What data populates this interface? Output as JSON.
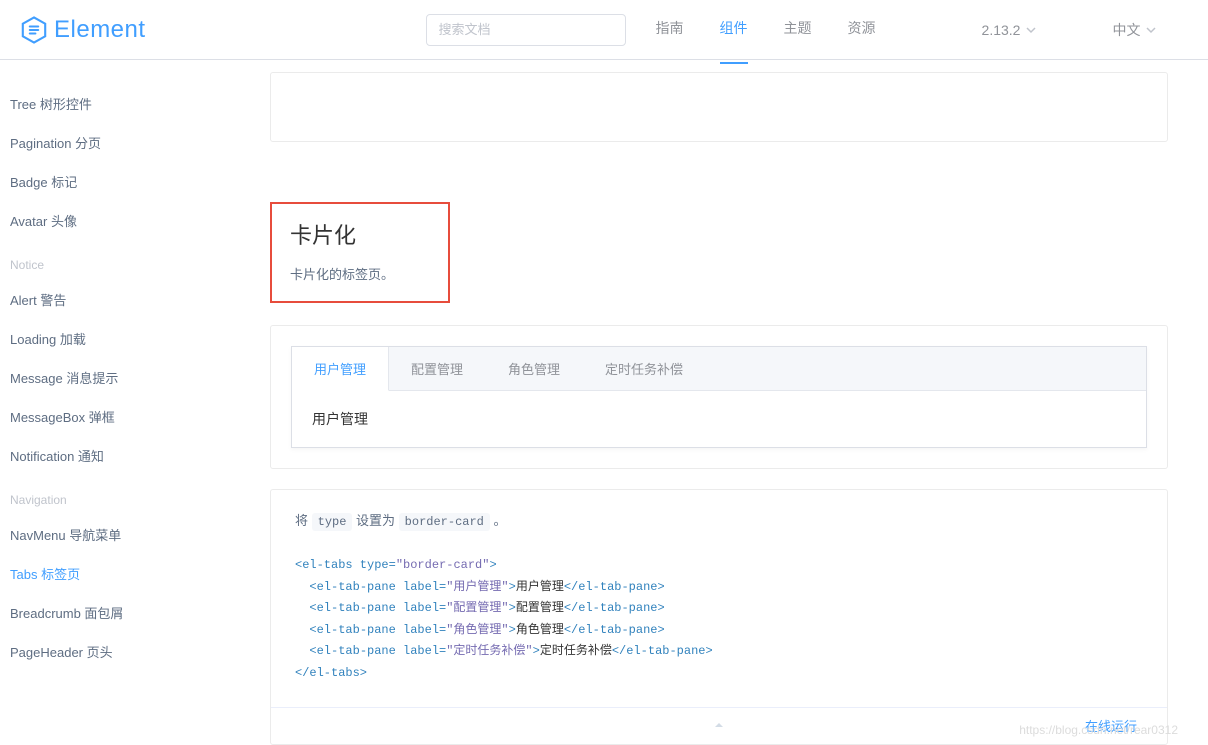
{
  "header": {
    "logo_text": "Element",
    "search_placeholder": "搜索文档",
    "nav": [
      {
        "label": "指南",
        "active": false
      },
      {
        "label": "组件",
        "active": true
      },
      {
        "label": "主题",
        "active": false
      },
      {
        "label": "资源",
        "active": false
      }
    ],
    "version": "2.13.2",
    "lang": "中文"
  },
  "sidebar": {
    "items_top": [
      "Tree 树形控件",
      "Pagination 分页",
      "Badge 标记",
      "Avatar 头像"
    ],
    "group_notice": "Notice",
    "items_notice": [
      "Alert 警告",
      "Loading 加载",
      "Message 消息提示",
      "MessageBox 弹框",
      "Notification 通知"
    ],
    "group_nav": "Navigation",
    "items_nav": [
      {
        "label": "NavMenu 导航菜单",
        "active": false
      },
      {
        "label": "Tabs 标签页",
        "active": true
      },
      {
        "label": "Breadcrumb 面包屑",
        "active": false
      },
      {
        "label": "PageHeader 页头",
        "active": false
      }
    ]
  },
  "section": {
    "title": "卡片化",
    "desc": "卡片化的标签页。"
  },
  "demo": {
    "tabs": [
      {
        "label": "用户管理",
        "active": true
      },
      {
        "label": "配置管理",
        "active": false
      },
      {
        "label": "角色管理",
        "active": false
      },
      {
        "label": "定时任务补偿",
        "active": false
      }
    ],
    "body": "用户管理"
  },
  "code_desc": {
    "pre": "将 ",
    "c1": "type",
    "mid": " 设置为 ",
    "c2": "border-card",
    "post": " 。"
  },
  "code": {
    "l1_open": "<el-tabs type=",
    "l1_str": "\"border-card\"",
    "l1_close": ">",
    "pane_open": "<el-tab-pane label=",
    "pane_close_start": ">",
    "pane_close_end": "</el-tab-pane>",
    "l2_str": "\"用户管理\"",
    "l2_text": "用户管理",
    "l3_str": "\"配置管理\"",
    "l3_text": "配置管理",
    "l4_str": "\"角色管理\"",
    "l4_text": "角色管理",
    "l5_str": "\"定时任务补偿\"",
    "l5_text": "定时任务补偿",
    "l6": "</el-tabs>"
  },
  "run_link": "在线运行",
  "watermark": "https://blog.csdn.net/rear0312"
}
